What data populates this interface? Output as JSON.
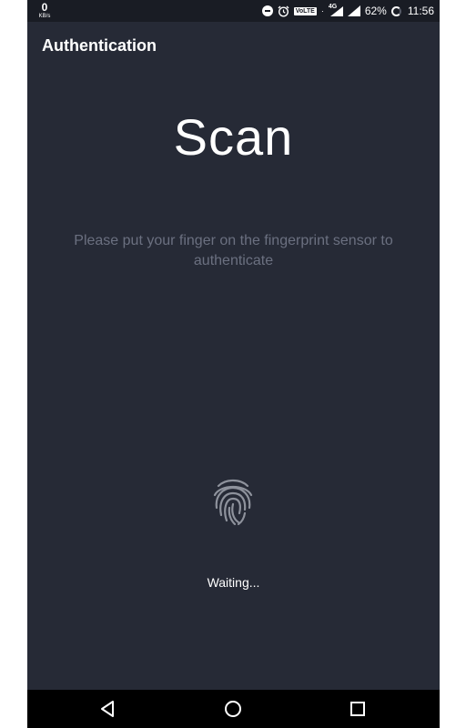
{
  "status_bar": {
    "net_speed_value": "0",
    "net_speed_unit": "KB/s",
    "network_type": "4G",
    "volte_label": "VoLTE",
    "battery_percent": "62%",
    "time": "11:56"
  },
  "toolbar": {
    "title": "Authentication"
  },
  "main": {
    "heading": "Scan",
    "instruction": "Please put your finger on the fingerprint sensor to authenticate",
    "status": "Waiting..."
  },
  "colors": {
    "background": "#262a36",
    "status_bar": "#191c24",
    "instruction_text": "#6b7080",
    "fingerprint": "#8e929c"
  },
  "icons": {
    "fingerprint": "fingerprint-icon",
    "back": "back-triangle-icon",
    "home": "home-circle-icon",
    "recents": "recents-square-icon"
  }
}
